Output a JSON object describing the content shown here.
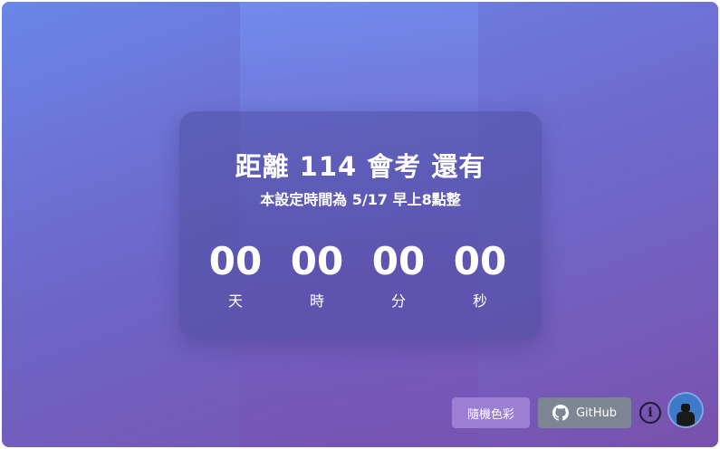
{
  "countdown": {
    "title": "距離 114 會考 還有",
    "subtitle": "本設定時間為 5/17 早上8點整",
    "units": [
      {
        "value": "00",
        "label": "天"
      },
      {
        "value": "00",
        "label": "時"
      },
      {
        "value": "00",
        "label": "分"
      },
      {
        "value": "00",
        "label": "秒"
      }
    ]
  },
  "footer": {
    "random_color_label": "隨機色彩",
    "github_label": "GitHub",
    "info_icon": "info-icon",
    "avatar_icon": "user-avatar"
  },
  "colors": {
    "background_start": "#6a86e8",
    "background_end": "#7a50ad",
    "card": "#46469673",
    "github_button": "#7d8692",
    "random_button": "#aa8cdc"
  }
}
